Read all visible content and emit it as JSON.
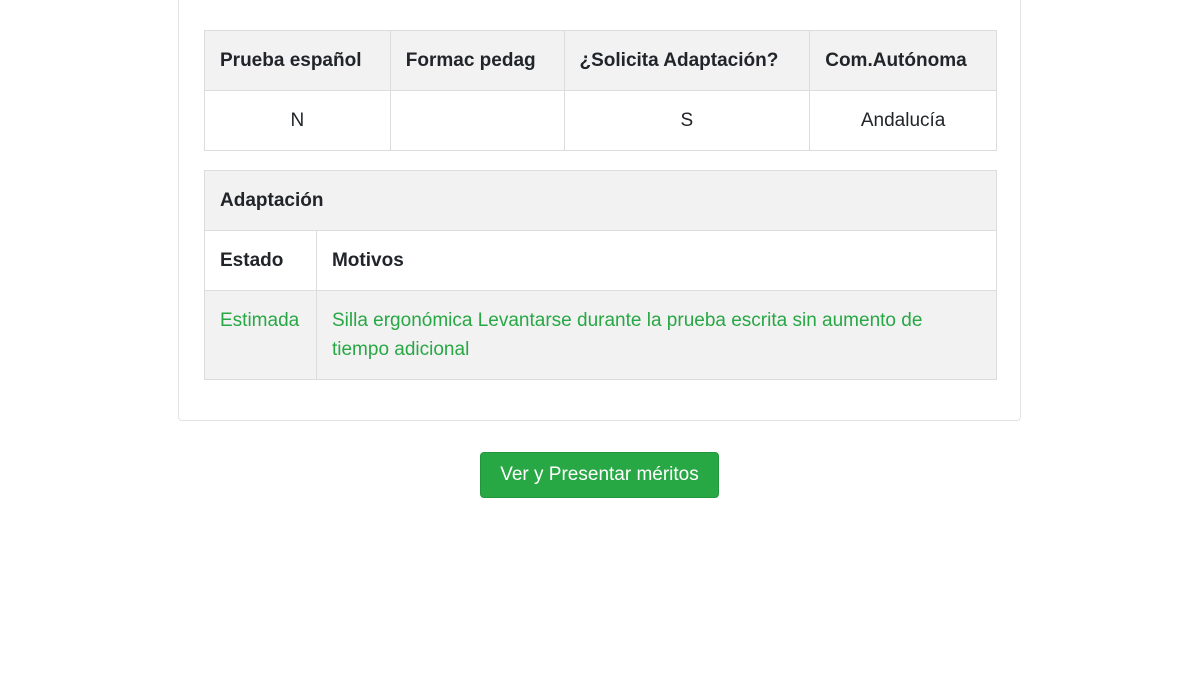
{
  "solicitud_table": {
    "headers": [
      "Prueba español",
      "Formac pedag",
      "¿Solicita Adaptación?",
      "Com.Autónoma"
    ],
    "row": [
      "N",
      "",
      "S",
      "Andalucía"
    ]
  },
  "adaptacion_table": {
    "title": "Adaptación",
    "headers": [
      "Estado",
      "Motivos"
    ],
    "row": {
      "estado": "Estimada",
      "motivos": "Silla ergonómica Levantarse durante la prueba escrita sin aumento de tiempo adicional"
    }
  },
  "actions": {
    "meritos_button": "Ver y Presentar méritos"
  },
  "colors": {
    "success": "#28a745",
    "header_bg": "#f2f2f2"
  }
}
